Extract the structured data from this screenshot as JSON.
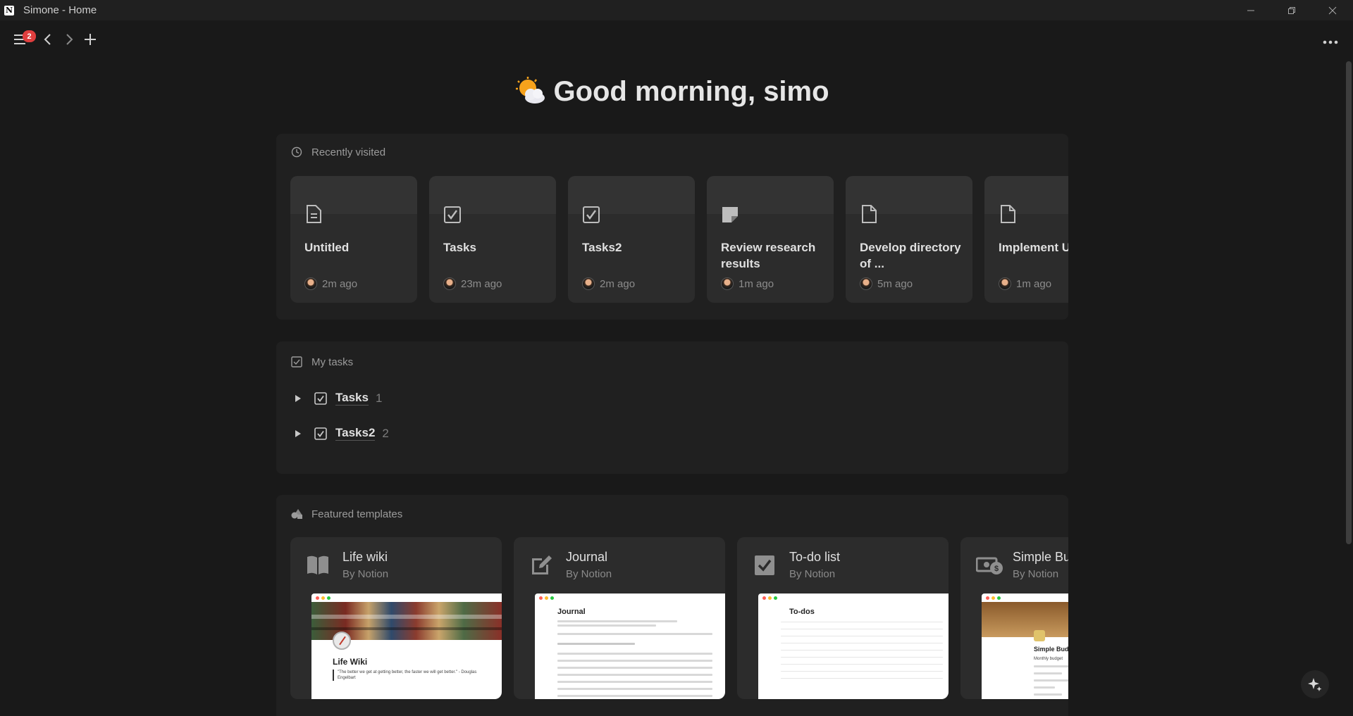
{
  "window": {
    "title": "Simone - Home",
    "logo_letter": "N"
  },
  "topbar": {
    "notification_count": "2",
    "more_label": "•••"
  },
  "greeting": {
    "text": "Good morning, simo"
  },
  "recently_visited": {
    "header": "Recently visited",
    "items": [
      {
        "title": "Untitled",
        "time": "2m ago",
        "icon": "page-icon"
      },
      {
        "title": "Tasks",
        "time": "23m ago",
        "icon": "checkbox-icon"
      },
      {
        "title": "Tasks2",
        "time": "2m ago",
        "icon": "checkbox-icon"
      },
      {
        "title": "Review research results",
        "time": "1m ago",
        "icon": "note-icon"
      },
      {
        "title": "Develop directory of ...",
        "time": "5m ago",
        "icon": "page-icon"
      },
      {
        "title": "Implement User Authentication",
        "time": "1m ago",
        "icon": "page-icon"
      }
    ]
  },
  "my_tasks": {
    "header": "My tasks",
    "groups": [
      {
        "name": "Tasks",
        "count": "1"
      },
      {
        "name": "Tasks2",
        "count": "2"
      }
    ]
  },
  "featured_templates": {
    "header": "Featured templates",
    "items": [
      {
        "title": "Life wiki",
        "by": "By Notion",
        "icon": "book-icon",
        "preview_title": "Life Wiki",
        "preview_quote": "\"The better we get at getting better, the faster we will get better.\" - Douglas Engelbart"
      },
      {
        "title": "Journal",
        "by": "By Notion",
        "icon": "edit-icon",
        "preview_title": "Journal"
      },
      {
        "title": "To-do list",
        "by": "By Notion",
        "icon": "checkbox-icon",
        "preview_title": "To-dos"
      },
      {
        "title": "Simple Budget",
        "by": "By Notion",
        "icon": "money-icon",
        "preview_title": "Simple Budget",
        "preview_subtitle": "Monthly budget"
      }
    ]
  },
  "colors": {
    "background": "#191919",
    "panel": "#202020",
    "card": "#2c2c2c",
    "badge": "#e03e3e"
  }
}
